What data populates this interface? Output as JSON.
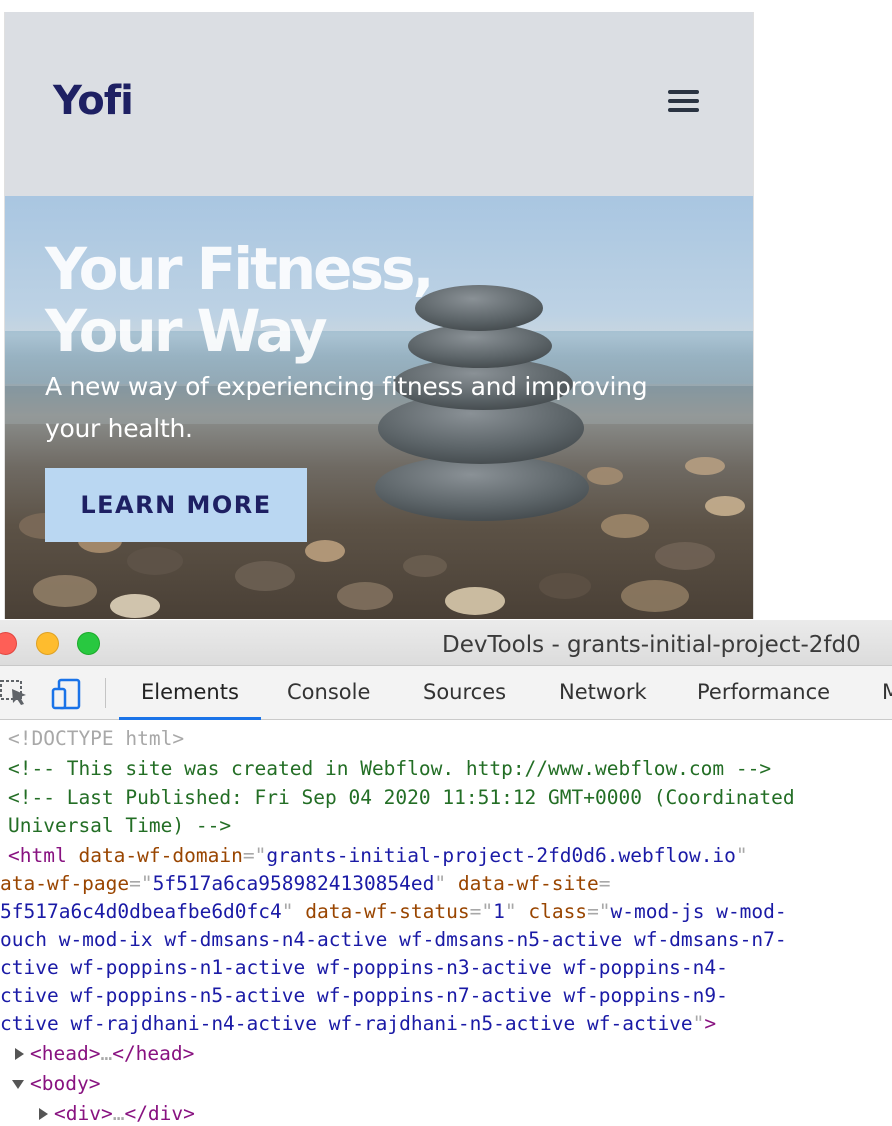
{
  "site": {
    "brand": "Yofi",
    "hero": {
      "title_line1": "Your Fitness,",
      "title_line2": "Your Way",
      "subtitle_line1": "A new way of experiencing fitness and improving",
      "subtitle_line2": "your health.",
      "cta_label": "LEARN MORE"
    },
    "colors": {
      "nav_bg": "#dbdee3",
      "brand": "#1e2063",
      "cta_bg": "#bad7f2"
    }
  },
  "devtools": {
    "window_title": "DevTools - grants-initial-project-2fd0",
    "tabs": [
      {
        "label": "Elements",
        "active": true
      },
      {
        "label": "Console"
      },
      {
        "label": "Sources"
      },
      {
        "label": "Network"
      },
      {
        "label": "Performance"
      },
      {
        "label": "M"
      }
    ],
    "icons": [
      "inspect-element-icon",
      "device-toolbar-icon"
    ],
    "code": {
      "doctype": "<!DOCTYPE html>",
      "comment1": "<!-- This site was created in Webflow. http://www.webflow.com -->",
      "comment2a": "<!-- Last Published: Fri Sep 04 2020 11:51:12 GMT+0000 (Coordinated",
      "comment2b": "Universal Time) -->",
      "html_open": "<",
      "html_tag": "html",
      "attr_domain": " data-wf-domain",
      "eq_q": "=\"",
      "val_domain": "grants-initial-project-2fd0d6.webflow.io",
      "q": "\"",
      "attr_page": "ata-wf-page",
      "val_page": "5f517a6ca9589824130854ed",
      "attr_site": " data-wf-site",
      "eq": "=",
      "val_site": "5f517a6c4d0dbeafbe6d0fc4",
      "attr_status": " data-wf-status",
      "val_status": "1",
      "attr_class": " class",
      "val_class_1": "w-mod-js w-mod-",
      "val_class_2": "ouch w-mod-ix wf-dmsans-n4-active wf-dmsans-n5-active wf-dmsans-n7-",
      "val_class_3": "ctive wf-poppins-n1-active wf-poppins-n3-active wf-poppins-n4-",
      "val_class_4": "ctive wf-poppins-n5-active wf-poppins-n7-active wf-poppins-n9-",
      "val_class_5": "ctive wf-rajdhani-n4-active wf-rajdhani-n5-active wf-active",
      "close_gt": ">",
      "head_line": "<head>…</head>",
      "head_open": "<head>",
      "ellipsis": "…",
      "head_close": "</head>",
      "body_open": "<body>",
      "div_open": "<div>",
      "div_close": "</div>"
    }
  }
}
